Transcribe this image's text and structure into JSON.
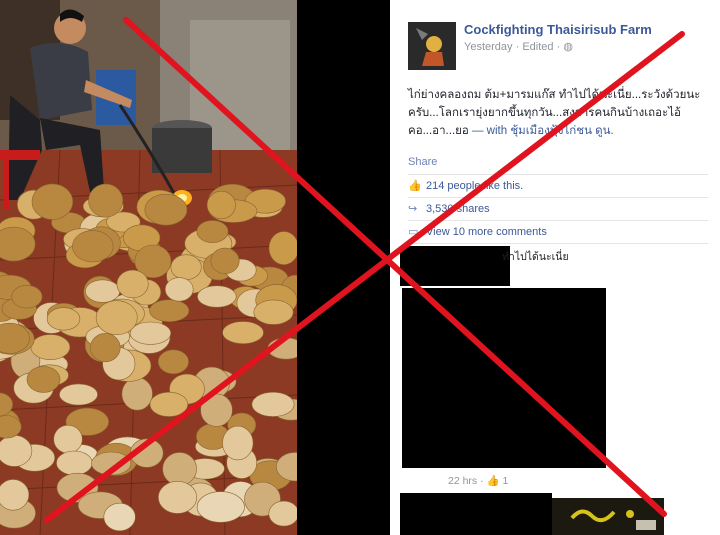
{
  "post": {
    "page_name": "Cockfighting Thaisirisub Farm",
    "time": "Yesterday",
    "separator": "·",
    "edited": "Edited",
    "privacy_icon": "globe-icon",
    "text_main": "ไก่ย่างคลองถม ต้ม+มารมแก๊ส ทำไปได้นะเนี่ย...ระวังด้วยนะครับ...โลกเรายุ่งยากขึ้นทุกวัน...สงสารคนกินบ้างเถอะไอ้คอ...อา...ยอ",
    "with_label": "— with",
    "tagged": "ชุ้มเมืองฟุ้งไก่ชน ดูน.",
    "share_label": "Share"
  },
  "stats": {
    "likes_text": "214 people like this.",
    "shares_text": "3,530 shares",
    "view_comments": "View 10 more comments"
  },
  "comment": {
    "snippet": "ทำไปได้นะเนี่ย",
    "time": "22 hrs",
    "likes": "1"
  },
  "colors": {
    "link": "#3b5998",
    "cross": "#e0141e"
  }
}
